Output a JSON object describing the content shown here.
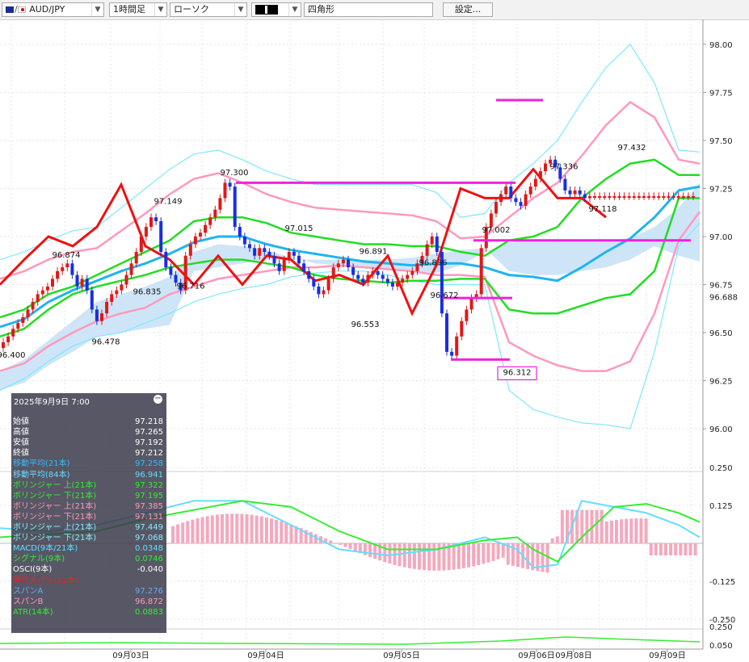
{
  "toolbar": {
    "symbol": "AUD/JPY",
    "timeframe": "1時間足",
    "chart_type": "ローソク",
    "draw_tool": "四角形",
    "settings_button": "設定..."
  },
  "axis": {
    "price_ticks": [
      "98.00",
      "97.75",
      "97.50",
      "97.25",
      "97.00",
      "96.75",
      "96.50",
      "96.25",
      "96.00"
    ],
    "current_price_label": "96.688",
    "macd_ticks": [
      "0.250",
      "0.125",
      "-0.125",
      "-0.250"
    ],
    "atr_ticks": [
      "0.250",
      "0.050"
    ],
    "date_labels": [
      "09月03日",
      "09月04日",
      "09月05日",
      "09月06日",
      "09月08日",
      "09月09日"
    ]
  },
  "annotations": [
    "97.300",
    "97.149",
    "96.874",
    "96.835",
    "96.716",
    "96.478",
    "96.400",
    "97.015",
    "96.891",
    "96.836",
    "96.672",
    "96.553",
    "97.002",
    "96.312",
    "97.336",
    "97.432",
    "97.118"
  ],
  "info_panel": {
    "datetime": "2025年9月9日  7:00",
    "rows": [
      {
        "label": "始値",
        "value": "97.218",
        "color": "#ffffff"
      },
      {
        "label": "高値",
        "value": "97.265",
        "color": "#ffffff"
      },
      {
        "label": "安値",
        "value": "97.192",
        "color": "#ffffff"
      },
      {
        "label": "終値",
        "value": "97.212",
        "color": "#ffffff"
      },
      {
        "label": "移動平均(21本)",
        "value": "97.258",
        "color": "#33bbff"
      },
      {
        "label": "移動平均(84本)",
        "value": "96.941",
        "color": "#66ddff"
      },
      {
        "label": "ボリンジャー 上(21本)",
        "value": "97.322",
        "color": "#33ee33"
      },
      {
        "label": "ボリンジャー 下(21本)",
        "value": "97.195",
        "color": "#33ee33"
      },
      {
        "label": "ボリンジャー 上(21本)",
        "value": "97.385",
        "color": "#ff99bb"
      },
      {
        "label": "ボリンジャー 下(21本)",
        "value": "97.131",
        "color": "#ff99bb"
      },
      {
        "label": "ボリンジャー 上(21本)",
        "value": "97.449",
        "color": "#88eeff"
      },
      {
        "label": "ボリンジャー 下(21本)",
        "value": "97.068",
        "color": "#88eeff"
      },
      {
        "label": "MACD(9本/21本)",
        "value": "0.0348",
        "color": "#66ddff"
      },
      {
        "label": "シグナル(9本)",
        "value": "0.0746",
        "color": "#33ee33"
      },
      {
        "label": "OSCI(9本)",
        "value": "-0.040",
        "color": "#ffffff"
      },
      {
        "label": "遅行スパン(21本)",
        "value": "-",
        "color": "#ee2222"
      },
      {
        "label": "スパンA",
        "value": "97.276",
        "color": "#66aaff"
      },
      {
        "label": "スパンB",
        "value": "96.872",
        "color": "#ff99bb"
      },
      {
        "label": "ATR(14本)",
        "value": "0.0883",
        "color": "#33ee33"
      }
    ]
  },
  "colors": {
    "bull_candle": "#e01818",
    "bear_candle": "#1a2ee0",
    "sma21": "#1fb4f0",
    "bollinger_1": "#22dd22",
    "bollinger_2": "#ff99bb",
    "bollinger_3": "#7ee8ff",
    "lagging_span": "#ee1111",
    "rect_lines": "#ee22dd",
    "cloud": "#c6e0f7"
  }
}
